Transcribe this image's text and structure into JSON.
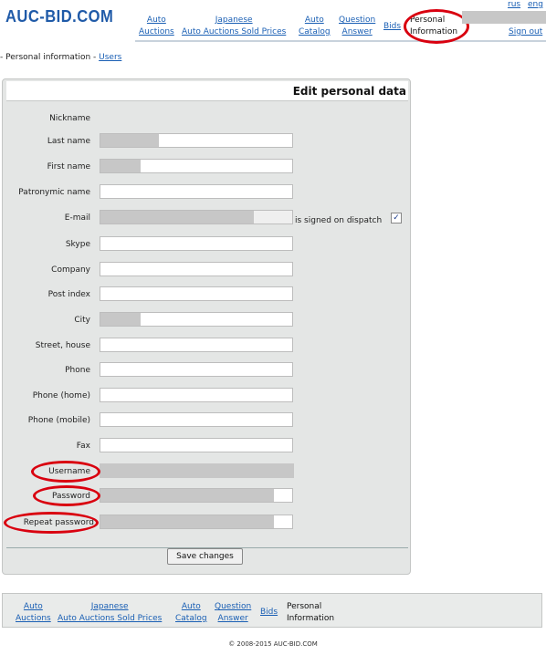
{
  "header": {
    "logo": "AUC-BID.COM",
    "lang": {
      "rus": "rus",
      "eng": "eng"
    },
    "sign_out": "Sign out",
    "nav": [
      {
        "line1": "Auto",
        "line2": "Auctions"
      },
      {
        "line1": "Japanese",
        "line2": "Auto Auctions Sold Prices"
      },
      {
        "line1": "Auto",
        "line2": "Catalog"
      },
      {
        "line1": "Question",
        "line2": "Answer"
      },
      {
        "line1": "Bids",
        "line2": ""
      }
    ],
    "active": {
      "line1": "Personal",
      "line2": "Information"
    }
  },
  "breadcrumb": {
    "prefix": "- Personal information - ",
    "link": "Users"
  },
  "form": {
    "title": "Edit personal data",
    "fields": {
      "nickname": {
        "label": "Nickname"
      },
      "last_name": {
        "label": "Last name"
      },
      "first_name": {
        "label": "First name"
      },
      "patronymic": {
        "label": "Patronymic name"
      },
      "email": {
        "label": "E-mail",
        "signed_label": "is signed on dispatch",
        "checked": true,
        "check_glyph": "✓"
      },
      "skype": {
        "label": "Skype"
      },
      "company": {
        "label": "Company"
      },
      "post_index": {
        "label": "Post index"
      },
      "city": {
        "label": "City"
      },
      "street": {
        "label": "Street, house"
      },
      "phone": {
        "label": "Phone"
      },
      "phone_home": {
        "label": "Phone (home)"
      },
      "phone_mobile": {
        "label": "Phone (mobile)"
      },
      "fax": {
        "label": "Fax"
      },
      "username": {
        "label": "Username"
      },
      "password": {
        "label": "Password"
      },
      "repeat_password": {
        "label": "Repeat password"
      }
    },
    "save_label": "Save changes"
  },
  "footer": {
    "nav": [
      {
        "line1": "Auto",
        "line2": "Auctions"
      },
      {
        "line1": "Japanese",
        "line2": "Auto Auctions Sold Prices"
      },
      {
        "line1": "Auto",
        "line2": "Catalog"
      },
      {
        "line1": "Question",
        "line2": "Answer"
      },
      {
        "line1": "Bids",
        "line2": ""
      }
    ],
    "active": {
      "line1": "Personal",
      "line2": "Information"
    },
    "copyright": "© 2008-2015 AUC-BID.COM"
  },
  "colors": {
    "link": "#1a5fb4",
    "logo": "#1f5aa8",
    "highlight_ellipse": "#d9000f",
    "panel_bg": "#e4e6e5",
    "redacted_fill": "#c7c7c7"
  }
}
